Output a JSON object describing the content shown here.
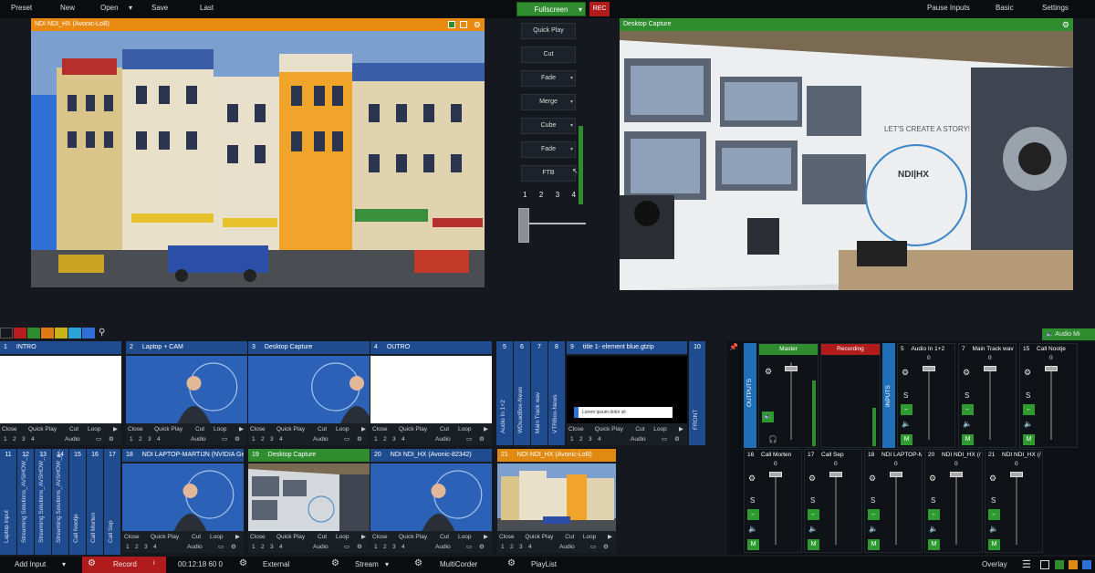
{
  "topmenu": {
    "preset": "Preset",
    "new": "New",
    "open": "Open",
    "save": "Save",
    "last": "Last",
    "fullscreen": "Fullscreen",
    "rec": "REC",
    "pause_inputs": "Pause Inputs",
    "basic": "Basic",
    "settings": "Settings"
  },
  "preview": {
    "title": "NDI NDI_HX (Avonic-LoB)"
  },
  "output": {
    "title": "Desktop Capture"
  },
  "transitions": {
    "quick_play": "Quick Play",
    "cut": "Cut",
    "fade": "Fade",
    "merge": "Merge",
    "cube": "Cube",
    "fade2": "Fade",
    "ftb": "FTB",
    "numbers": [
      "1",
      "2",
      "3",
      "4"
    ]
  },
  "audio_mixer_tab": "Audio Mi",
  "color_tabs": [
    "#b81e1e",
    "#2e8b2e",
    "#e07a12",
    "#c8b417",
    "#2aa3d9",
    "#2f6fd6"
  ],
  "row1": [
    {
      "num": "1",
      "title": "INTRO",
      "thumb": "white"
    },
    {
      "num": "2",
      "title": "Laptop + CAM",
      "thumb": "blue-person"
    },
    {
      "num": "3",
      "title": "Desktop Capture",
      "thumb": "blue-person-edge"
    },
    {
      "num": "4",
      "title": "OUTRO",
      "thumb": "white"
    }
  ],
  "row1_vertical": [
    {
      "num": "5",
      "label": "Audio In 1+2"
    },
    {
      "num": "6",
      "label": "WDuadBox-News"
    },
    {
      "num": "7",
      "label": "Main Track wav"
    },
    {
      "num": "8",
      "label": "VTRBox-News"
    }
  ],
  "tile9": {
    "num": "9",
    "title": "title 1- element blue.gtzip",
    "lowerthird": "Lorem ipsum dolor sit"
  },
  "tile10": {
    "num": "10",
    "label": "FRONT"
  },
  "row2_vertical": [
    {
      "num": "11",
      "label": "Laptop input"
    },
    {
      "num": "12",
      "label": "Streaming Solutions_AVSHOW_..."
    },
    {
      "num": "13",
      "label": "Streaming Solutions_AVSHOW_..."
    },
    {
      "num": "14",
      "label": "Streaming Solutions_AVSHOW_p..."
    },
    {
      "num": "15",
      "label": "Call Nootje"
    },
    {
      "num": "16",
      "label": "Call Morten"
    },
    {
      "num": "17",
      "label": "Call Sep"
    }
  ],
  "row2": [
    {
      "num": "18",
      "title": "NDI LAPTOP-MARTIJN (NVIDIA GeF",
      "head": "#1f4c8f"
    },
    {
      "num": "19",
      "title": "Desktop Capture",
      "head": "#2f8c2f"
    },
    {
      "num": "20",
      "title": "NDI NDI_HX (Avonic-82342)",
      "head": "#1f4c8f"
    },
    {
      "num": "21",
      "title": "NDI NDI_HX (Avonic-LoB)",
      "head": "#e08a12"
    }
  ],
  "controls": {
    "close": "Close",
    "quick_play": "Quick Play",
    "cut": "Cut",
    "loop": "Loop",
    "n1": "1",
    "n2": "2",
    "n3": "3",
    "n4": "4",
    "audio": "Audio"
  },
  "mixer": {
    "outputs_label": "OUTPUTS",
    "inputs_label": "INPUTS",
    "master": "Master",
    "recording": "Recording",
    "top_inputs": [
      {
        "num": "5",
        "name": "Audio In 1+2",
        "value": "0"
      },
      {
        "num": "7",
        "name": "Main Track wav",
        "value": "0"
      },
      {
        "num": "15",
        "name": "Call Nootje",
        "value": "0"
      }
    ],
    "bottom_inputs": [
      {
        "num": "16",
        "name": "Call Morten",
        "value": "0"
      },
      {
        "num": "17",
        "name": "Call Sep",
        "value": "0"
      },
      {
        "num": "18",
        "name": "NDI LAPTOP-M",
        "value": "0"
      },
      {
        "num": "20",
        "name": "NDI NDI_HX (/",
        "value": "0"
      },
      {
        "num": "21",
        "name": "NDI NDI_HX (/",
        "value": "0"
      }
    ],
    "m_label": "M",
    "s_label": "S"
  },
  "bottombar": {
    "add_input": "Add Input",
    "record": "Record",
    "timer": "00:12:18 60 0",
    "external": "External",
    "stream": "Stream",
    "multicorder": "MultiCorder",
    "playlist": "PlayList",
    "overlay": "Overlay"
  },
  "slide_text": {
    "headline": "LET'S CREATE A STORY!",
    "brand": "NDI|HX"
  }
}
